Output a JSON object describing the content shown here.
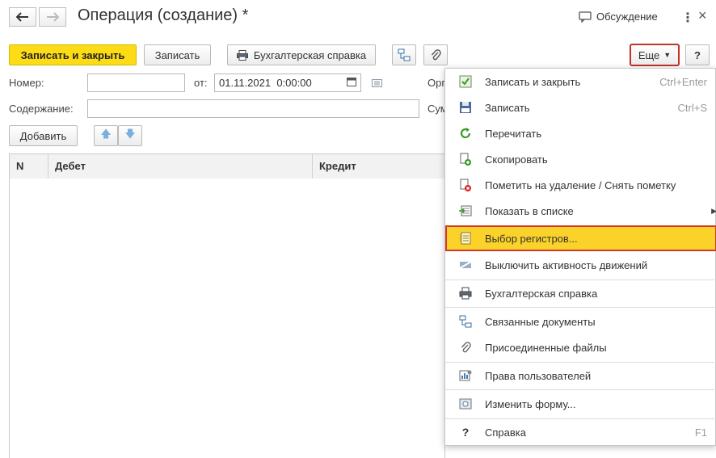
{
  "header": {
    "title": "Операция (создание) *",
    "discussion": "Обсуждение"
  },
  "toolbar": {
    "save_close": "Записать и закрыть",
    "save": "Записать",
    "report": "Бухгалтерская справка",
    "more": "Еще",
    "help": "?"
  },
  "form": {
    "number_label": "Номер:",
    "date_label": "от:",
    "date_value": "01.11.2021  0:00:00",
    "org_label": "Орг",
    "content_label": "Содержание:",
    "sum_label": "Сум",
    "add_button": "Добавить"
  },
  "table": {
    "columns": [
      "N",
      "Дебет",
      "Кредит"
    ]
  },
  "menu": {
    "items": [
      {
        "label": "Записать и закрыть",
        "shortcut": "Ctrl+Enter",
        "icon": "save-close-icon"
      },
      {
        "label": "Записать",
        "shortcut": "Ctrl+S",
        "icon": "floppy-icon"
      },
      {
        "label": "Перечитать",
        "shortcut": "",
        "icon": "refresh-icon"
      },
      {
        "label": "Скопировать",
        "shortcut": "",
        "icon": "copy-icon"
      },
      {
        "label": "Пометить на удаление / Снять пометку",
        "shortcut": "",
        "icon": "delete-mark-icon"
      },
      {
        "label": "Показать в списке",
        "shortcut": "",
        "icon": "show-in-list-icon"
      },
      {
        "label": "Выбор регистров...",
        "shortcut": "",
        "icon": "registers-icon"
      },
      {
        "label": "Выключить активность движений",
        "shortcut": "",
        "icon": "deactivate-icon"
      },
      {
        "label": "Бухгалтерская справка",
        "shortcut": "",
        "icon": "printer-icon"
      },
      {
        "label": "Связанные документы",
        "shortcut": "",
        "icon": "linked-docs-icon"
      },
      {
        "label": "Присоединенные файлы",
        "shortcut": "",
        "icon": "paperclip-icon"
      },
      {
        "label": "Права пользователей",
        "shortcut": "",
        "icon": "user-rights-icon"
      },
      {
        "label": "Изменить форму...",
        "shortcut": "",
        "icon": "form-settings-icon"
      },
      {
        "label": "Справка",
        "shortcut": "F1",
        "icon": "help-icon"
      }
    ]
  },
  "colors": {
    "accent": "#fddc15",
    "highlight": "#fbd22a",
    "highlight_border": "#d23a2a"
  }
}
